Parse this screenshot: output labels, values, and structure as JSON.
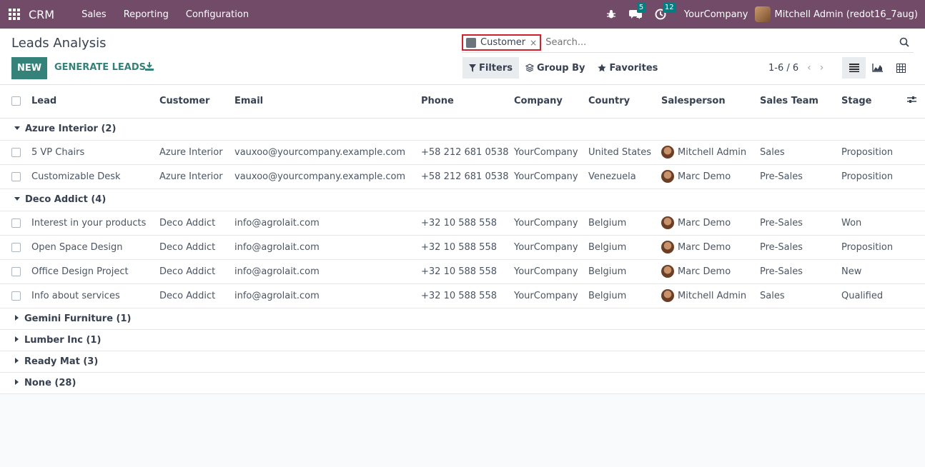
{
  "navbar": {
    "brand": "CRM",
    "menu": [
      "Sales",
      "Reporting",
      "Configuration"
    ],
    "messages_count": "5",
    "activities_count": "12",
    "company": "YourCompany",
    "user": "Mitchell Admin (redot16_7aug)"
  },
  "control": {
    "title": "Leads Analysis",
    "new_label": "NEW",
    "generate_label": "GENERATE LEADS",
    "facet_value": "Customer",
    "facet_remove": "×",
    "search_placeholder": "Search...",
    "filters_label": "Filters",
    "groupby_label": "Group By",
    "favorites_label": "Favorites",
    "pager": "1-6 / 6"
  },
  "columns": [
    "Lead",
    "Customer",
    "Email",
    "Phone",
    "Company",
    "Country",
    "Salesperson",
    "Sales Team",
    "Stage"
  ],
  "groups": [
    {
      "label": "Azure Interior (2)",
      "expanded": true,
      "rows": [
        {
          "lead": "5 VP Chairs",
          "customer": "Azure Interior",
          "email": "vauxoo@yourcompany.example.com",
          "phone": "+58 212 681 0538",
          "company": "YourCompany",
          "country": "United States",
          "salesperson": "Mitchell Admin",
          "team": "Sales",
          "stage": "Proposition"
        },
        {
          "lead": "Customizable Desk",
          "customer": "Azure Interior",
          "email": "vauxoo@yourcompany.example.com",
          "phone": "+58 212 681 0538",
          "company": "YourCompany",
          "country": "Venezuela",
          "salesperson": "Marc Demo",
          "team": "Pre-Sales",
          "stage": "Proposition"
        }
      ]
    },
    {
      "label": "Deco Addict (4)",
      "expanded": true,
      "rows": [
        {
          "lead": "Interest in your products",
          "customer": "Deco Addict",
          "email": "info@agrolait.com",
          "phone": "+32 10 588 558",
          "company": "YourCompany",
          "country": "Belgium",
          "salesperson": "Marc Demo",
          "team": "Pre-Sales",
          "stage": "Won"
        },
        {
          "lead": "Open Space Design",
          "customer": "Deco Addict",
          "email": "info@agrolait.com",
          "phone": "+32 10 588 558",
          "company": "YourCompany",
          "country": "Belgium",
          "salesperson": "Marc Demo",
          "team": "Pre-Sales",
          "stage": "Proposition"
        },
        {
          "lead": "Office Design Project",
          "customer": "Deco Addict",
          "email": "info@agrolait.com",
          "phone": "+32 10 588 558",
          "company": "YourCompany",
          "country": "Belgium",
          "salesperson": "Marc Demo",
          "team": "Pre-Sales",
          "stage": "New"
        },
        {
          "lead": "Info about services",
          "customer": "Deco Addict",
          "email": "info@agrolait.com",
          "phone": "+32 10 588 558",
          "company": "YourCompany",
          "country": "Belgium",
          "salesperson": "Mitchell Admin",
          "team": "Sales",
          "stage": "Qualified"
        }
      ]
    },
    {
      "label": "Gemini Furniture (1)",
      "expanded": false,
      "rows": []
    },
    {
      "label": "Lumber Inc (1)",
      "expanded": false,
      "rows": []
    },
    {
      "label": "Ready Mat (3)",
      "expanded": false,
      "rows": []
    },
    {
      "label": "None (28)",
      "expanded": false,
      "rows": []
    }
  ],
  "icons": {
    "apps": "apps-grid-icon",
    "debug": "bug-icon",
    "messages": "chat-icon",
    "activities": "clock-icon",
    "download": "download-icon",
    "facet": "layers-icon",
    "search": "search-icon",
    "filter": "filter-icon",
    "groupby": "layers-icon",
    "favorites": "star-icon",
    "list_view": "list-view-icon",
    "graph_view": "area-chart-icon",
    "pivot_view": "pivot-table-icon",
    "optional_columns": "sliders-icon"
  },
  "colors": {
    "navbar": "#714b67",
    "primary": "#35827a",
    "badge": "#017e84",
    "facet_border": "#d0202e"
  }
}
